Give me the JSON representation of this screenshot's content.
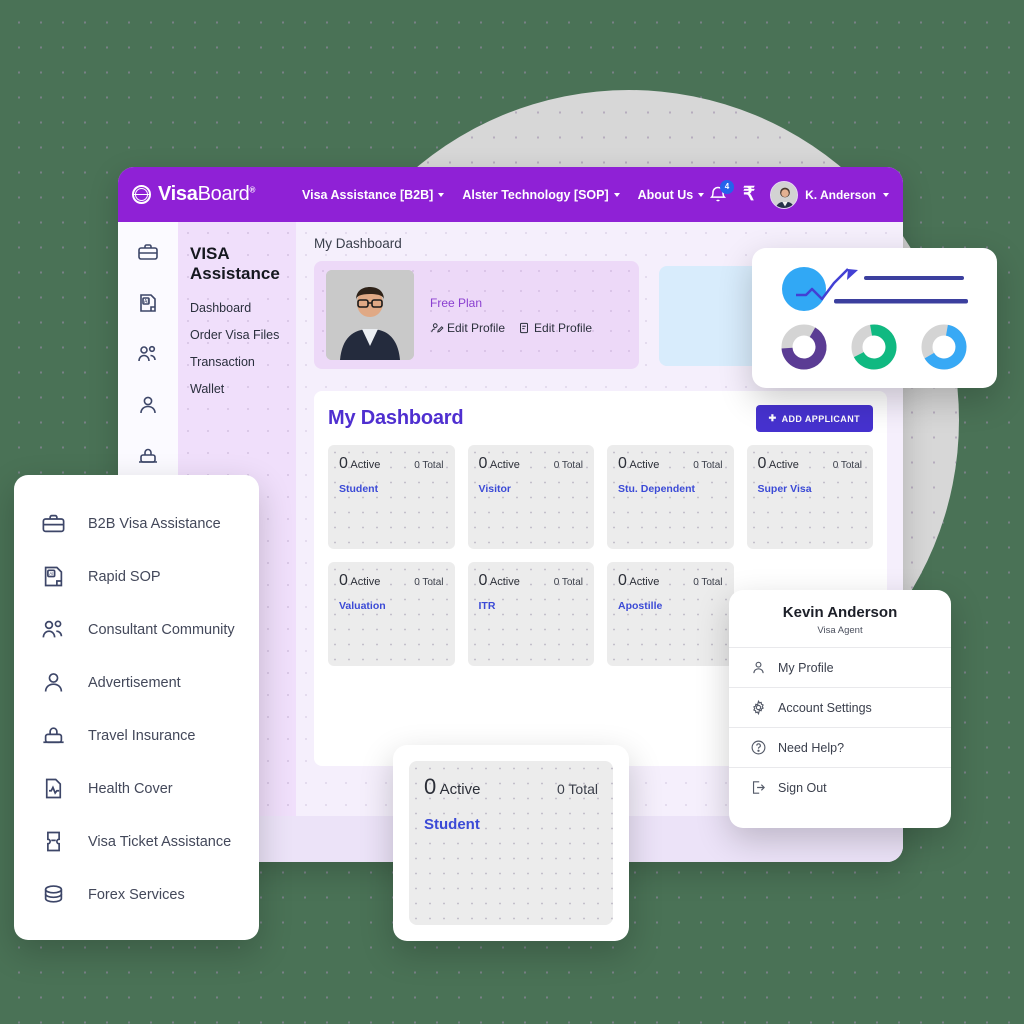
{
  "brand": {
    "name_bold": "Visa",
    "name_light": "Board",
    "trademark": "®",
    "logo_icon": "globe-icon"
  },
  "topnav": {
    "items": [
      {
        "label": "Visa Assistance [B2B]",
        "has_caret": true
      },
      {
        "label": "Alster Technology [SOP]",
        "has_caret": true
      },
      {
        "label": "About Us",
        "has_caret": true
      }
    ],
    "notification_count": "4",
    "currency_symbol": "₹",
    "user_label": "K. Anderson"
  },
  "icon_rail": [
    {
      "icon": "briefcase-icon"
    },
    {
      "icon": "ai-document-icon"
    },
    {
      "icon": "community-icon"
    },
    {
      "icon": "person-icon"
    },
    {
      "icon": "travel-insurance-icon"
    },
    {
      "icon": "health-document-icon"
    }
  ],
  "sidebar": {
    "title": "VISA Assistance",
    "items": [
      {
        "label": "Dashboard"
      },
      {
        "label": "Order Visa Files"
      },
      {
        "label": "Transaction"
      },
      {
        "label": "Wallet"
      }
    ]
  },
  "main": {
    "page_title": "My Dashboard",
    "profile": {
      "plan": "Free Plan",
      "edit_primary": "Edit Profile",
      "edit_secondary": "Edit Profile"
    },
    "dashboard": {
      "title": "My Dashboard",
      "add_button": "ADD APPLICANT",
      "stats": [
        {
          "count": "0",
          "active_label": "Active",
          "total": "0 Total",
          "label": "Student"
        },
        {
          "count": "0",
          "active_label": "Active",
          "total": "0 Total",
          "label": "Visitor"
        },
        {
          "count": "0",
          "active_label": "Active",
          "total": "0 Total",
          "label": "Stu. Dependent"
        },
        {
          "count": "0",
          "active_label": "Active",
          "total": "0 Total",
          "label": "Super Visa"
        },
        {
          "count": "0",
          "active_label": "Active",
          "total": "0 Total",
          "label": "Valuation"
        },
        {
          "count": "0",
          "active_label": "Active",
          "total": "0 Total",
          "label": "ITR"
        },
        {
          "count": "0",
          "active_label": "Active",
          "total": "0 Total",
          "label": "Apostille"
        }
      ]
    }
  },
  "services_menu": {
    "items": [
      {
        "label": "B2B Visa Assistance",
        "icon": "briefcase-icon"
      },
      {
        "label": "Rapid SOP",
        "icon": "ai-document-icon"
      },
      {
        "label": "Consultant Community",
        "icon": "community-icon"
      },
      {
        "label": "Advertisement",
        "icon": "person-icon"
      },
      {
        "label": "Travel Insurance",
        "icon": "travel-insurance-icon"
      },
      {
        "label": "Health Cover",
        "icon": "health-document-icon"
      },
      {
        "label": "Visa Ticket Assistance",
        "icon": "ticket-icon"
      },
      {
        "label": "Forex Services",
        "icon": "coins-icon"
      }
    ]
  },
  "user_dropdown": {
    "name": "Kevin Anderson",
    "role": "Visa Agent",
    "items": [
      {
        "label": "My Profile",
        "icon": "person-icon"
      },
      {
        "label": "Account Settings",
        "icon": "gear-icon"
      },
      {
        "label": "Need Help?",
        "icon": "question-circle-icon"
      },
      {
        "label": "Sign Out",
        "icon": "sign-out-icon"
      }
    ]
  },
  "magnified_stat": {
    "count": "0",
    "active_label": "Active",
    "total": "0 Total",
    "label": "Student"
  },
  "chart_widget": {
    "type": "mixed",
    "donuts": [
      {
        "name": "purple-donut",
        "color": "#5b3c94",
        "track": "#d4d4d4",
        "percent": 66
      },
      {
        "name": "green-donut",
        "color": "#10b981",
        "track": "#d4d4d4",
        "percent": 70
      },
      {
        "name": "blue-donut",
        "color": "#38a9f5",
        "track": "#d4d4d4",
        "percent": 64
      }
    ],
    "circle_color": "#31a8f5",
    "trend_color": "#4240d4",
    "bar_color": "#3b3f9e"
  },
  "colors": {
    "brand_purple": "#8f21d6",
    "accent_indigo": "#4632cf",
    "dashboard_title": "#4f2fd0",
    "stat_label": "#3b4ad6",
    "background_green": "#4a7256",
    "panel_lavender": "#f0dffb",
    "blue_panel": "#d8ecfc"
  }
}
